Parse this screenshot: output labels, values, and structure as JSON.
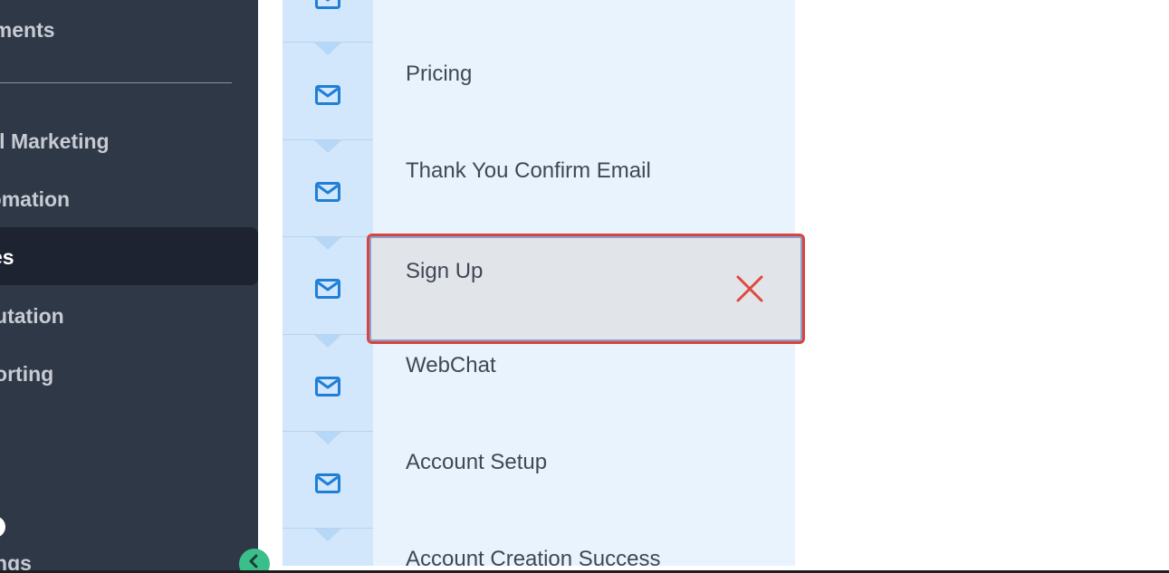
{
  "sidebar": {
    "items": [
      {
        "label": "yments"
      },
      {
        "label": "ail Marketing"
      },
      {
        "label": "tomation"
      },
      {
        "label": "es"
      },
      {
        "label": "putation"
      },
      {
        "label": "porting"
      },
      {
        "label": "tings"
      }
    ],
    "collapse_icon": "chevron-left-icon"
  },
  "list": {
    "row_icon": "mail-icon",
    "rows": [
      {
        "label": "Pricing"
      },
      {
        "label": "Thank You Confirm Email"
      },
      {
        "label": "Sign Up"
      },
      {
        "label": "WebChat"
      },
      {
        "label": "Account Setup"
      },
      {
        "label": "Account Creation Success"
      }
    ],
    "highlight_delete_icon": "close-icon"
  },
  "colors": {
    "sidebar_bg": "#2f3847",
    "sidebar_active_bg": "#1d2330",
    "list_bg": "#e8f3fe",
    "icon_column_bg": "#d2e7fb",
    "icon_blue": "#1f7fd6",
    "highlight_border": "#d8453b",
    "delete_red": "#e0483e",
    "collapse_green": "#3bbf8a"
  }
}
